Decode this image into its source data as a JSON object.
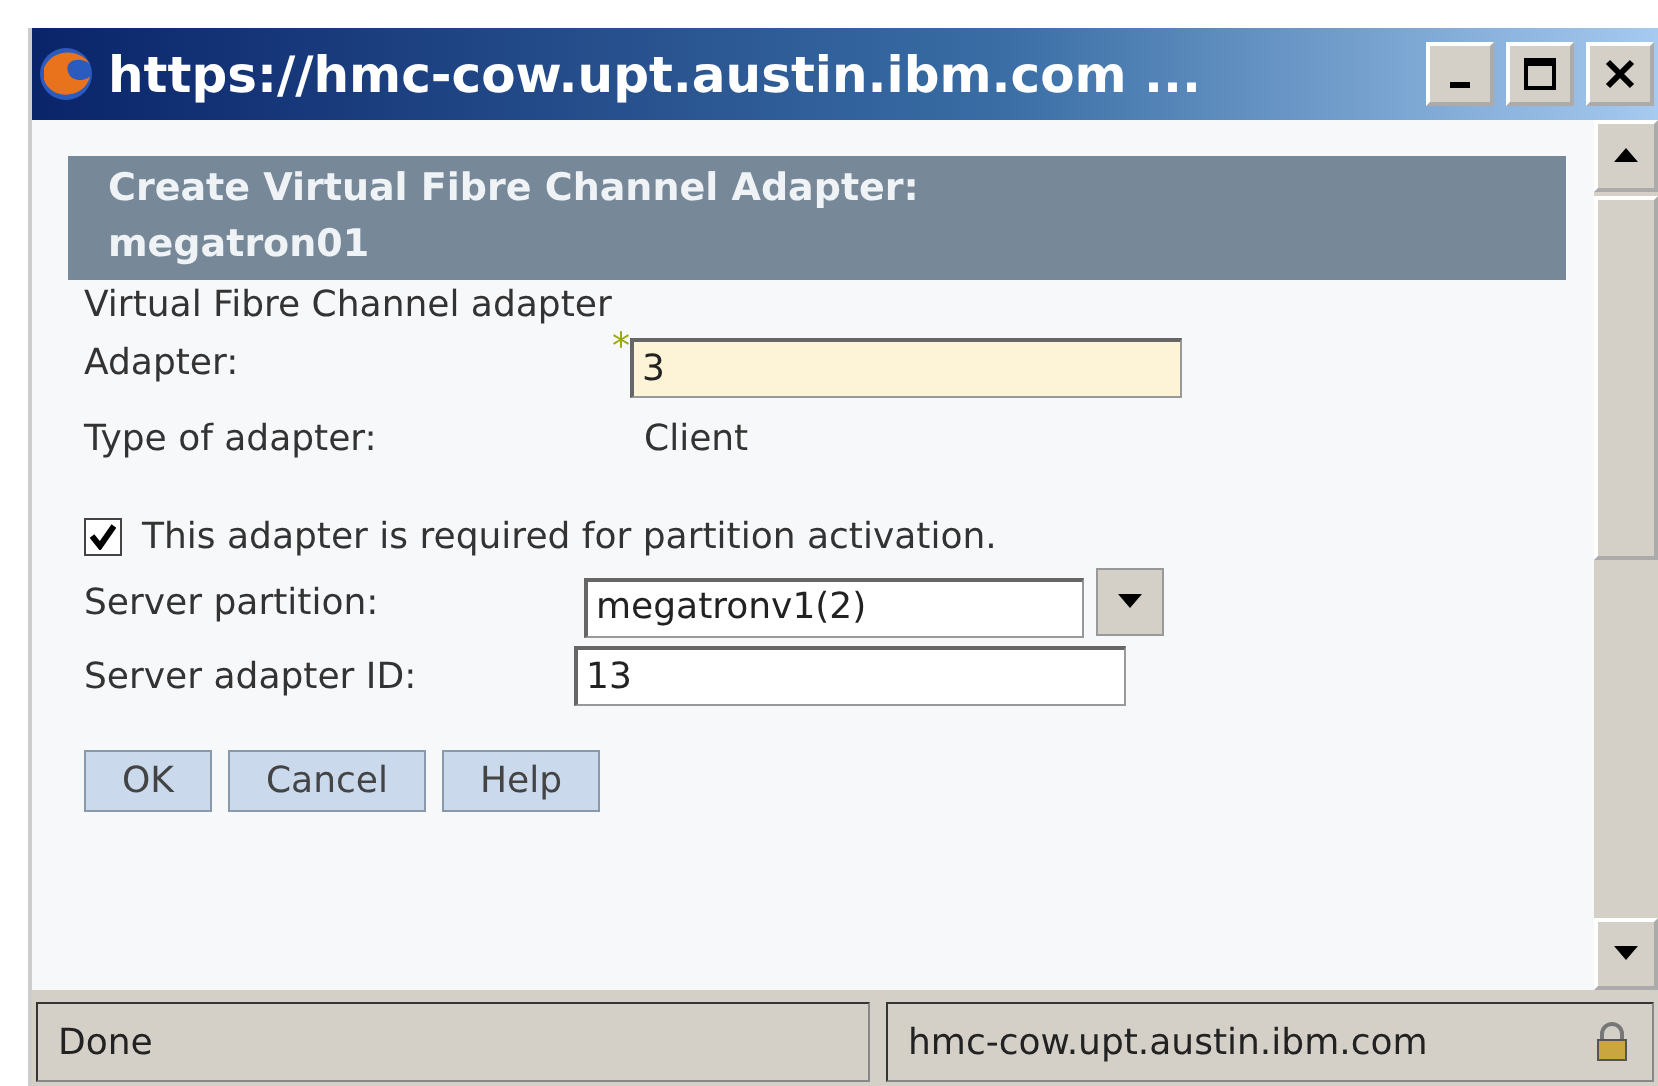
{
  "window": {
    "title": "https://hmc-cow.upt.austin.ibm.com ..."
  },
  "header": {
    "title": "Create Virtual Fibre Channel Adapter: megatron01"
  },
  "section_label": "Virtual Fibre Channel adapter",
  "adapter": {
    "label": "Adapter:",
    "required_mark": "*",
    "value": "3"
  },
  "type": {
    "label": "Type of adapter:",
    "value": "Client"
  },
  "required_checkbox": {
    "label": "This adapter is required for partition activation.",
    "checked": true
  },
  "server_partition": {
    "label": "Server partition:",
    "value": "megatronv1(2)"
  },
  "server_adapter_id": {
    "label": "Server adapter ID:",
    "value": "13"
  },
  "buttons": [
    "OK",
    "Cancel",
    "Help"
  ],
  "status_bar": {
    "status": "Done",
    "host": "hmc-cow.upt.austin.ibm.com"
  }
}
